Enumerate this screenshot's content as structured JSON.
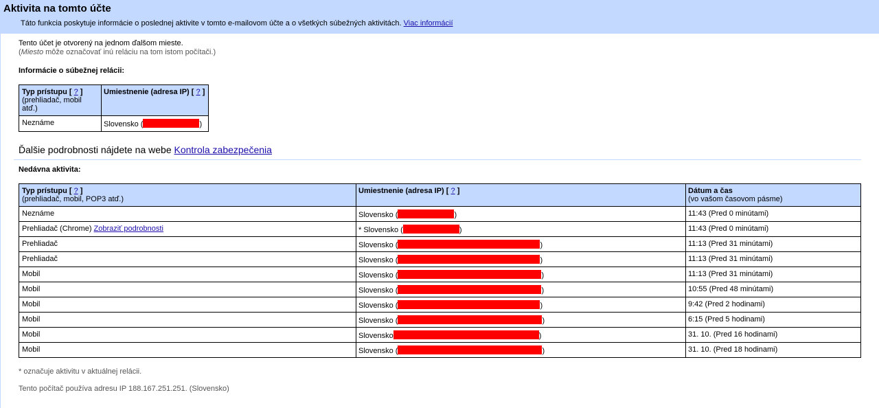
{
  "header": {
    "title": "Aktivita na tomto účte",
    "description": "Táto funkcia poskytuje informácie o poslednej aktivite v tomto e-mailovom účte a o všetkých súbežných aktivitách.",
    "more_link": "Viac informácií"
  },
  "intro": {
    "line1": "Tento účet je otvorený na jednom ďalšom mieste.",
    "line2_prefix": "(",
    "line2_em": "Miesto",
    "line2_suffix": " môže označovať inú reláciu na tom istom počítači.)"
  },
  "concurrent": {
    "title": "Informácie o súbežnej relácii:",
    "headers": {
      "type_label": "Typ prístupu",
      "type_sub": "(prehliadač, mobil atď.)",
      "location_label": "Umiestnenie (adresa IP)",
      "help": "?"
    },
    "row": {
      "type": "Neznáme",
      "location": "Slovensko (",
      "close": ")"
    }
  },
  "security": {
    "text": "Ďalšie podrobnosti nájdete na webe",
    "link": "Kontrola zabezpečenia"
  },
  "recent": {
    "title": "Nedávna aktivita:",
    "headers": {
      "type_label": "Typ prístupu",
      "type_sub": "(prehliadač, mobil, POP3 atď.)",
      "location_label": "Umiestnenie (adresa IP)",
      "date_label": "Dátum a čas",
      "date_sub": "(vo vašom časovom pásme)",
      "help": "?"
    },
    "details_link": "Zobraziť podrobnosti",
    "rows": [
      {
        "type": "Neznáme",
        "location": "Slovensko (",
        "close": ")",
        "time": "11:43 (Pred 0 minútami)"
      },
      {
        "type": "Prehliadač (Chrome)",
        "location": "* Slovensko (",
        "close": ")",
        "time": "11:43 (Pred 0 minútami)"
      },
      {
        "type": "Prehliadač",
        "location": "Slovensko (",
        "close": ")",
        "time": "11:13 (Pred 31 minútami)"
      },
      {
        "type": "Prehliadač",
        "location": "Slovensko (",
        "close": ")",
        "time": "11:13 (Pred 31 minútami)"
      },
      {
        "type": "Mobil",
        "location": "Slovensko (",
        "close": ")",
        "time": "11:13 (Pred 31 minútami)"
      },
      {
        "type": "Mobil",
        "location": "Slovensko (",
        "close": ")",
        "time": "10:55 (Pred 48 minútami)"
      },
      {
        "type": "Mobil",
        "location": "Slovensko (",
        "close": ")",
        "time": "9:42 (Pred 2 hodinami)"
      },
      {
        "type": "Mobil",
        "location": "Slovensko (",
        "close": ")",
        "time": "6:15 (Pred 5 hodinami)"
      },
      {
        "type": "Mobil",
        "location": "Slovensko",
        "close": ")",
        "time": "31. 10. (Pred 16 hodinami)"
      },
      {
        "type": "Mobil",
        "location": "Slovensko (",
        "close": ")",
        "time": "31. 10. (Pred 18 hodinami)"
      }
    ]
  },
  "footer": {
    "note": "* označuje aktivitu v aktuálnej relácii.",
    "ip": "Tento počítač používa adresu IP 188.167.251.251. (Slovensko)"
  }
}
